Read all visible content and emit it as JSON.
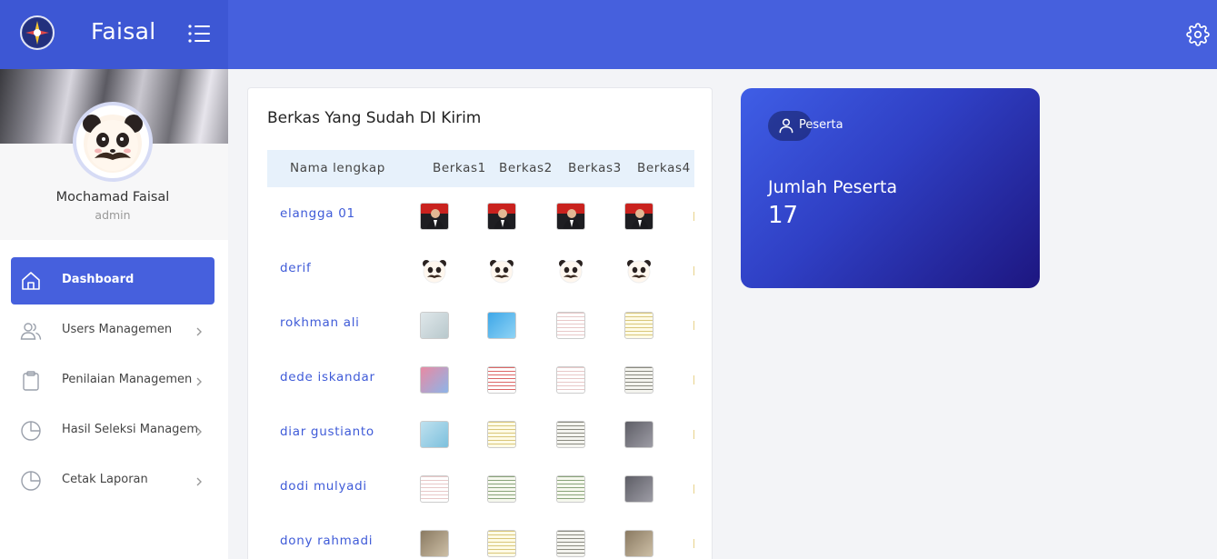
{
  "brand": {
    "name": "Faisal"
  },
  "profile": {
    "name": "Mochamad Faisal",
    "role": "admin"
  },
  "nav": [
    {
      "label": "Dashboard",
      "icon": "home-icon",
      "active": true
    },
    {
      "label": "Users Managemen",
      "icon": "users-icon"
    },
    {
      "label": "Penilaian Managemen",
      "icon": "clipboard-icon"
    },
    {
      "label": "Hasil Seleksi Manageme",
      "icon": "pie-chart-icon"
    },
    {
      "label": "Cetak Laporan",
      "icon": "pie-chart-icon"
    }
  ],
  "table": {
    "title": "Berkas Yang Sudah DI Kirim",
    "headers": [
      "Nama lengkap",
      "Berkas1",
      "Berkas2",
      "Berkas3",
      "Berkas4"
    ],
    "rows": [
      {
        "name": "elangga 01",
        "files": [
          "photo-red",
          "photo-red",
          "photo-red",
          "photo-red"
        ]
      },
      {
        "name": "derif",
        "files": [
          "panda",
          "panda",
          "panda",
          "panda"
        ]
      },
      {
        "name": "rokhman ali",
        "files": [
          "doc-light",
          "doc-blue",
          "doc-white",
          "doc-yellow"
        ]
      },
      {
        "name": "dede iskandar",
        "files": [
          "doc-pink",
          "doc-red",
          "doc-white",
          "doc-gray"
        ]
      },
      {
        "name": "diar gustianto",
        "files": [
          "doc-blue-light",
          "doc-yellow",
          "doc-gray",
          "doc-dark"
        ]
      },
      {
        "name": "dodi mulyadi",
        "files": [
          "doc-white",
          "doc-green",
          "doc-green",
          "doc-dark"
        ]
      },
      {
        "name": "dony rahmadi",
        "files": [
          "doc-brown",
          "doc-yellow",
          "doc-gray",
          "doc-brown"
        ]
      }
    ]
  },
  "stat": {
    "badge": "Peserta",
    "label": "Jumlah Peserta",
    "value": "17"
  },
  "colors": {
    "primary": "#4660dd",
    "link": "#3f5bd8"
  }
}
